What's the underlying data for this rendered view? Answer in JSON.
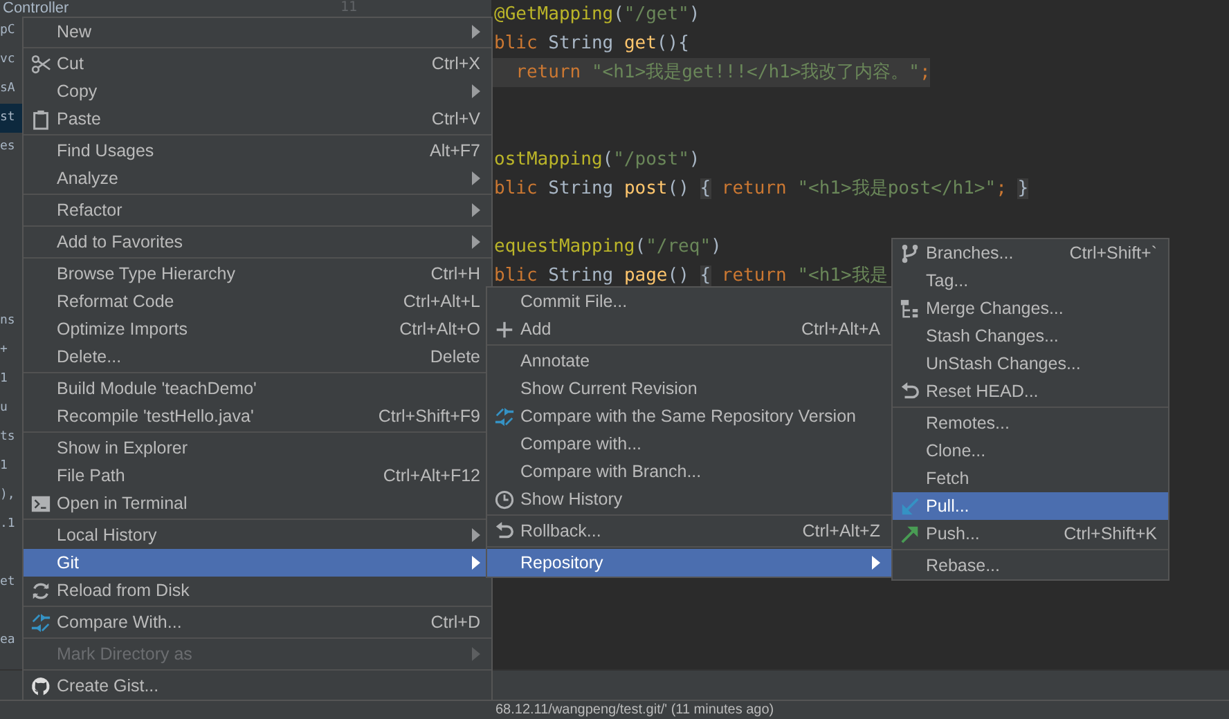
{
  "project_tree": {
    "header": "Controller",
    "line_number": "11",
    "fragments": [
      {
        "text": "pC",
        "selected": false
      },
      {
        "text": "vc",
        "selected": false
      },
      {
        "text": "sA",
        "selected": false
      },
      {
        "text": "st",
        "selected": true
      },
      {
        "text": "es",
        "selected": false
      },
      {
        "text": "ns",
        "selected": false
      },
      {
        "text": "+",
        "selected": false
      },
      {
        "text": "1",
        "selected": false
      },
      {
        "text": "u",
        "selected": false
      },
      {
        "text": "ts",
        "selected": false
      },
      {
        "text": "1",
        "selected": false
      },
      {
        "text": "),",
        "selected": false
      },
      {
        "text": ".1",
        "selected": false
      },
      {
        "text": "et",
        "selected": false
      },
      {
        "text": "ea",
        "selected": false
      }
    ]
  },
  "code_lines": [
    {
      "current": false,
      "tokens": [
        {
          "kind": "annotation",
          "text": "@GetMapping"
        },
        {
          "kind": "plain",
          "text": "("
        },
        {
          "kind": "string",
          "text": "\"/get\""
        },
        {
          "kind": "plain",
          "text": ")"
        }
      ]
    },
    {
      "current": false,
      "tokens": [
        {
          "kind": "keyword",
          "text": "blic "
        },
        {
          "kind": "plain",
          "text": "String "
        },
        {
          "kind": "method",
          "text": "get"
        },
        {
          "kind": "plain",
          "text": "(){"
        }
      ]
    },
    {
      "current": true,
      "tokens": [
        {
          "kind": "keyword",
          "text": "  return "
        },
        {
          "kind": "string",
          "text": "\"<h1>我是get!!!</h1>我改了内容。\""
        },
        {
          "kind": "keyword",
          "text": ";"
        }
      ]
    },
    {
      "current": false,
      "tokens": [
        {
          "kind": "annotation",
          "text": "ostMapping"
        },
        {
          "kind": "plain",
          "text": "("
        },
        {
          "kind": "string",
          "text": "\"/post\""
        },
        {
          "kind": "plain",
          "text": ")"
        }
      ]
    },
    {
      "current": false,
      "tokens": [
        {
          "kind": "keyword",
          "text": "blic "
        },
        {
          "kind": "plain",
          "text": "String "
        },
        {
          "kind": "method",
          "text": "post"
        },
        {
          "kind": "plain",
          "text": "() "
        },
        {
          "kind": "fold",
          "text": "{"
        },
        {
          "kind": "keyword",
          "text": " return "
        },
        {
          "kind": "string",
          "text": "\"<h1>我是post</h1>\""
        },
        {
          "kind": "keyword",
          "text": "; "
        },
        {
          "kind": "fold",
          "text": "}"
        }
      ]
    },
    {
      "current": false,
      "tokens": [
        {
          "kind": "annotation",
          "text": "equestMapping"
        },
        {
          "kind": "plain",
          "text": "("
        },
        {
          "kind": "string",
          "text": "\"/req\""
        },
        {
          "kind": "plain",
          "text": ")"
        }
      ]
    },
    {
      "current": false,
      "tokens": [
        {
          "kind": "keyword",
          "text": "blic "
        },
        {
          "kind": "plain",
          "text": "String "
        },
        {
          "kind": "method",
          "text": "page"
        },
        {
          "kind": "plain",
          "text": "() "
        },
        {
          "kind": "fold",
          "text": "{"
        },
        {
          "kind": "keyword",
          "text": " return "
        },
        {
          "kind": "string",
          "text": "\"<h1>我是"
        }
      ]
    }
  ],
  "status_bar": {
    "text": "68.12.11/wangpeng/test.git/' (11 minutes ago)"
  },
  "main_menu": {
    "groups": [
      {
        "items": [
          {
            "label": "New",
            "submenu": true,
            "selected": false,
            "disabled": false
          }
        ]
      },
      {
        "items": [
          {
            "label": "Cut",
            "shortcut": "Ctrl+X",
            "submenu": false,
            "selected": false,
            "disabled": false
          },
          {
            "label": "Copy",
            "submenu": true,
            "selected": false,
            "disabled": false
          },
          {
            "label": "Paste",
            "shortcut": "Ctrl+V",
            "submenu": false,
            "selected": false,
            "disabled": false
          }
        ]
      },
      {
        "items": [
          {
            "label": "Find Usages",
            "shortcut": "Alt+F7",
            "submenu": false,
            "selected": false,
            "disabled": false
          },
          {
            "label": "Analyze",
            "submenu": true,
            "selected": false,
            "disabled": false
          }
        ]
      },
      {
        "items": [
          {
            "label": "Refactor",
            "submenu": true,
            "selected": false,
            "disabled": false
          }
        ]
      },
      {
        "items": [
          {
            "label": "Add to Favorites",
            "submenu": true,
            "selected": false,
            "disabled": false
          }
        ]
      },
      {
        "items": [
          {
            "label": "Browse Type Hierarchy",
            "shortcut": "Ctrl+H",
            "submenu": false,
            "selected": false,
            "disabled": false
          },
          {
            "label": "Reformat Code",
            "shortcut": "Ctrl+Alt+L",
            "submenu": false,
            "selected": false,
            "disabled": false
          },
          {
            "label": "Optimize Imports",
            "shortcut": "Ctrl+Alt+O",
            "submenu": false,
            "selected": false,
            "disabled": false
          },
          {
            "label": "Delete...",
            "shortcut": "Delete",
            "submenu": false,
            "selected": false,
            "disabled": false
          }
        ]
      },
      {
        "items": [
          {
            "label": "Build Module 'teachDemo'",
            "submenu": false,
            "selected": false,
            "disabled": false
          },
          {
            "label": "Recompile 'testHello.java'",
            "shortcut": "Ctrl+Shift+F9",
            "submenu": false,
            "selected": false,
            "disabled": false
          }
        ]
      },
      {
        "items": [
          {
            "label": "Show in Explorer",
            "submenu": false,
            "selected": false,
            "disabled": false
          },
          {
            "label": "File Path",
            "shortcut": "Ctrl+Alt+F12",
            "submenu": false,
            "selected": false,
            "disabled": false
          },
          {
            "label": "Open in Terminal",
            "submenu": false,
            "selected": false,
            "disabled": false
          }
        ]
      },
      {
        "items": [
          {
            "label": "Local History",
            "submenu": true,
            "selected": false,
            "disabled": false
          },
          {
            "label": "Git",
            "submenu": true,
            "selected": true,
            "disabled": false
          },
          {
            "label": "Reload from Disk",
            "submenu": false,
            "selected": false,
            "disabled": false
          }
        ]
      },
      {
        "items": [
          {
            "label": "Compare With...",
            "shortcut": "Ctrl+D",
            "submenu": false,
            "selected": false,
            "disabled": false
          }
        ]
      },
      {
        "items": [
          {
            "label": "Mark Directory as",
            "submenu": true,
            "selected": false,
            "disabled": true
          }
        ]
      },
      {
        "items": [
          {
            "label": "Create Gist...",
            "submenu": false,
            "selected": false,
            "disabled": false
          }
        ]
      }
    ]
  },
  "git_menu": {
    "groups": [
      {
        "items": [
          {
            "label": "Commit File...",
            "submenu": false,
            "selected": false,
            "disabled": false
          },
          {
            "label": "Add",
            "shortcut": "Ctrl+Alt+A",
            "submenu": false,
            "selected": false,
            "disabled": false
          }
        ]
      },
      {
        "items": [
          {
            "label": "Annotate",
            "submenu": false,
            "selected": false,
            "disabled": false
          },
          {
            "label": "Show Current Revision",
            "submenu": false,
            "selected": false,
            "disabled": false
          },
          {
            "label": "Compare with the Same Repository Version",
            "submenu": false,
            "selected": false,
            "disabled": false
          },
          {
            "label": "Compare with...",
            "submenu": false,
            "selected": false,
            "disabled": false
          },
          {
            "label": "Compare with Branch...",
            "submenu": false,
            "selected": false,
            "disabled": false
          },
          {
            "label": "Show History",
            "submenu": false,
            "selected": false,
            "disabled": false
          }
        ]
      },
      {
        "items": [
          {
            "label": "Rollback...",
            "shortcut": "Ctrl+Alt+Z",
            "submenu": false,
            "selected": false,
            "disabled": false
          }
        ]
      },
      {
        "items": [
          {
            "label": "Repository",
            "submenu": true,
            "selected": true,
            "disabled": false
          }
        ]
      }
    ]
  },
  "repository_menu": {
    "groups": [
      {
        "items": [
          {
            "label": "Branches...",
            "shortcut": "Ctrl+Shift+`",
            "submenu": false,
            "selected": false,
            "disabled": false
          },
          {
            "label": "Tag...",
            "submenu": false,
            "selected": false,
            "disabled": false
          },
          {
            "label": "Merge Changes...",
            "submenu": false,
            "selected": false,
            "disabled": false
          },
          {
            "label": "Stash Changes...",
            "submenu": false,
            "selected": false,
            "disabled": false
          },
          {
            "label": "UnStash Changes...",
            "submenu": false,
            "selected": false,
            "disabled": false
          },
          {
            "label": "Reset HEAD...",
            "submenu": false,
            "selected": false,
            "disabled": false
          }
        ]
      },
      {
        "items": [
          {
            "label": "Remotes...",
            "submenu": false,
            "selected": false,
            "disabled": false
          },
          {
            "label": "Clone...",
            "submenu": false,
            "selected": false,
            "disabled": false
          },
          {
            "label": "Fetch",
            "submenu": false,
            "selected": false,
            "disabled": false
          },
          {
            "label": "Pull...",
            "submenu": false,
            "selected": true,
            "disabled": false
          },
          {
            "label": "Push...",
            "shortcut": "Ctrl+Shift+K",
            "submenu": false,
            "selected": false,
            "disabled": false
          }
        ]
      },
      {
        "items": [
          {
            "label": "Rebase...",
            "submenu": false,
            "selected": false,
            "disabled": false
          }
        ]
      }
    ]
  }
}
